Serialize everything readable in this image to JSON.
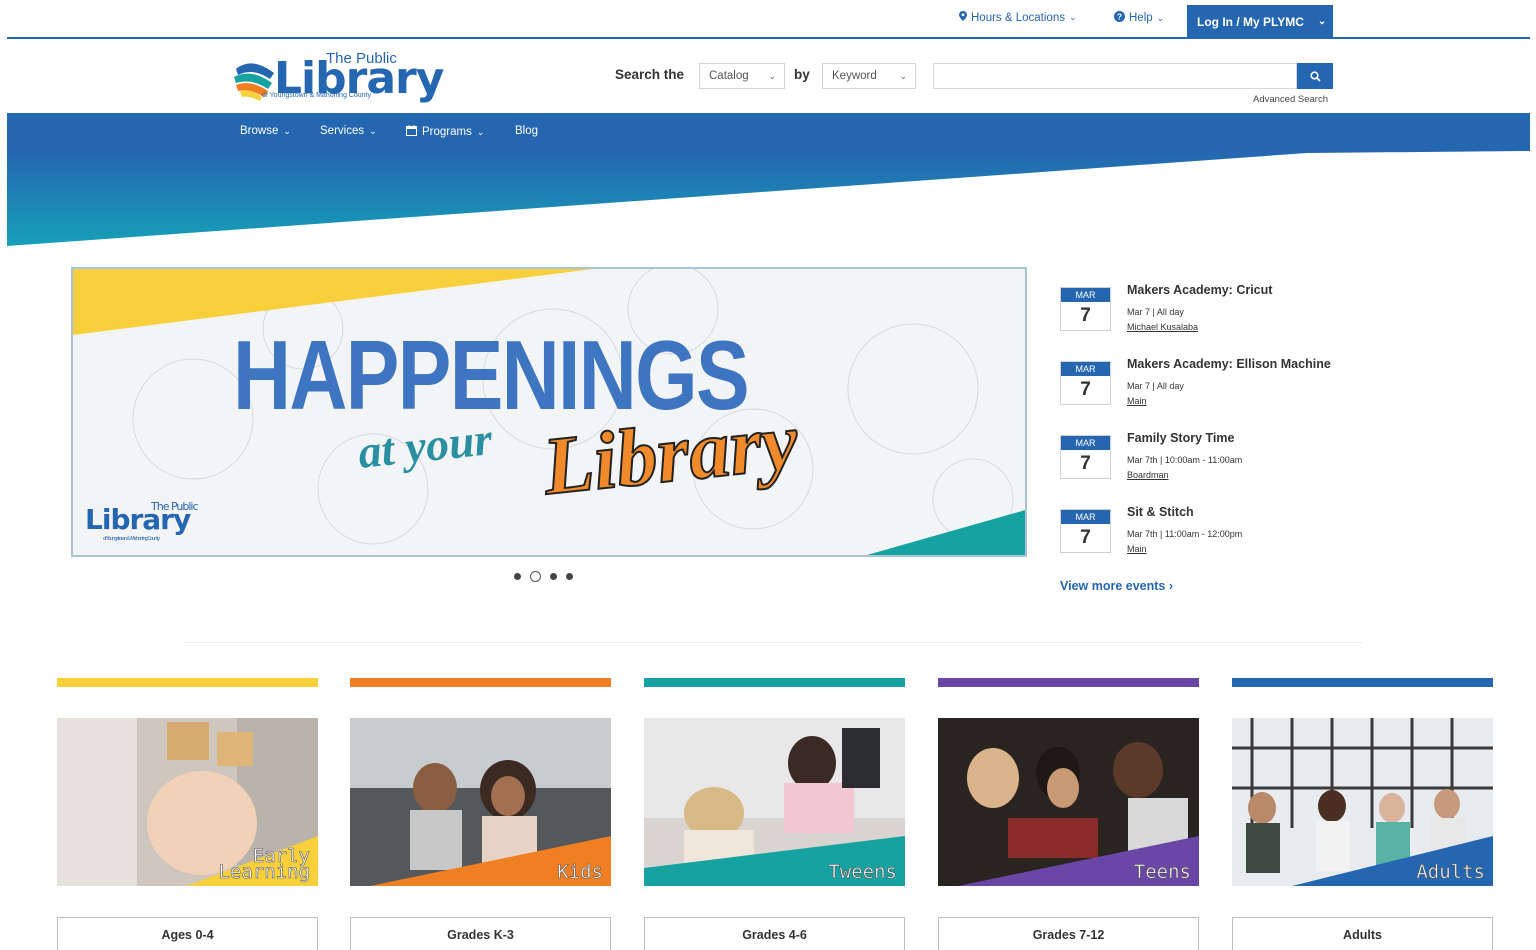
{
  "utility": {
    "hours_label": "Hours & Locations",
    "help_label": "Help",
    "login_label": "Log In / My PLYMC"
  },
  "header": {
    "logo_title_small": "The Public",
    "logo_title_big": "Library",
    "logo_subtitle": "of Youngstown & Mahoning County",
    "search_label": "Search the",
    "catalog_select": "Catalog",
    "by_label": "by",
    "keyword_select": "Keyword",
    "search_value": "",
    "advanced_search": "Advanced Search"
  },
  "nav": {
    "items": [
      {
        "label": "Browse"
      },
      {
        "label": "Services"
      },
      {
        "label": "Programs"
      },
      {
        "label": "Blog"
      }
    ]
  },
  "slider": {
    "headline": "HAPPENINGS",
    "script_1": "at your",
    "script_2": "Library",
    "logo_big": "Library",
    "logo_small": "The Public",
    "logo_sub": "of Youngstown & Mahoning County",
    "slide_count": 4,
    "active_slide": 2
  },
  "events": {
    "items": [
      {
        "month": "MAR",
        "day": "7",
        "title": "Makers Academy: Cricut",
        "time": "Mar 7 | All day",
        "location": "Michael Kusalaba"
      },
      {
        "month": "MAR",
        "day": "7",
        "title": "Makers Academy: Ellison Machine",
        "time": "Mar 7 | All day",
        "location": "Main"
      },
      {
        "month": "MAR",
        "day": "7",
        "title": "Family Story Time",
        "time": "Mar 7th | 10:00am - 11:00am",
        "location": "Boardman"
      },
      {
        "month": "MAR",
        "day": "7",
        "title": "Sit & Stitch",
        "time": "Mar 7th | 11:00am - 12:00pm",
        "location": "Main"
      }
    ],
    "view_more": "View more events ›"
  },
  "audiences": [
    {
      "label_1": "Early",
      "label_2": "Learning",
      "button": "Ages 0-4",
      "color": "#f7d03c"
    },
    {
      "label_1": "",
      "label_2": "Kids",
      "button": "Grades K-3",
      "color": "#ef7f22"
    },
    {
      "label_1": "",
      "label_2": "Tweens",
      "button": "Grades 4-6",
      "color": "#16a2a0"
    },
    {
      "label_1": "",
      "label_2": "Teens",
      "button": "Grades 7-12",
      "color": "#6a46a6"
    },
    {
      "label_1": "",
      "label_2": "Adults",
      "button": "Adults",
      "color": "#2566b0"
    }
  ],
  "colors": {
    "brand_blue": "#2566b0",
    "teal": "#16a2a0",
    "yellow": "#f7d03c",
    "orange": "#ef7f22",
    "purple": "#6a46a6"
  }
}
